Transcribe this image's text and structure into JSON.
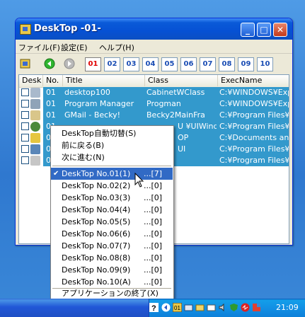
{
  "window": {
    "title": "DeskTop -01-",
    "minimize_glyph": "_",
    "maximize_glyph": "□",
    "close_glyph": "✕"
  },
  "menubar": [
    "ファイル(F)",
    "設定(E)",
    "ヘルプ(H)"
  ],
  "toolbar": {
    "tabs": [
      "01",
      "02",
      "03",
      "04",
      "05",
      "06",
      "07",
      "08",
      "09",
      "10"
    ],
    "active_tab": "01",
    "back_icon": "green-back-arrow-icon",
    "forward_icon": "gray-forward-arrow-icon",
    "menu_icon": "app-menu-icon"
  },
  "list": {
    "columns": [
      "Desk",
      "No.",
      "Title",
      "Class",
      "ExecName"
    ],
    "rows": [
      {
        "no": "01",
        "title": "desktop100",
        "class": "CabinetWClass",
        "exec": "C:¥WINDOWS¥Explo",
        "icon": "desktop-icon"
      },
      {
        "no": "01",
        "title": "Program Manager",
        "class": "Progman",
        "exec": "C:¥WINDOWS¥Explo",
        "icon": "program-manager-icon"
      },
      {
        "no": "01",
        "title": "GMail - Becky!",
        "class": "Becky2MainFra",
        "exec": "C:¥Program Files¥E",
        "icon": "becky-mail-icon"
      },
      {
        "no": "01",
        "title": "",
        "class": "U ¥UIWindo",
        "exec": "C:¥Program Files¥",
        "icon": "globe-icon"
      },
      {
        "no": "01",
        "title": "",
        "class": "OP",
        "exec": "C:¥Documents and",
        "icon": "folder-icon"
      },
      {
        "no": "01",
        "title": "",
        "class": "UI",
        "exec": "C:¥Program Files¥",
        "icon": "network-icon"
      },
      {
        "no": "01",
        "title": "",
        "class": "",
        "exec": "C:¥Program Files¥E",
        "icon": "music-icon"
      }
    ]
  },
  "context_menu": {
    "top_items": [
      "DeskTop自動切替(S)",
      "前に戻る(B)",
      "次に進む(N)"
    ],
    "desktops": [
      {
        "label": "DeskTop No.01(1)",
        "count": "...[7]",
        "checked": true
      },
      {
        "label": "DeskTop No.02(2)",
        "count": "...[0]",
        "checked": false
      },
      {
        "label": "DeskTop No.03(3)",
        "count": "...[0]",
        "checked": false
      },
      {
        "label": "DeskTop No.04(4)",
        "count": "...[0]",
        "checked": false
      },
      {
        "label": "DeskTop No.05(5)",
        "count": "...[0]",
        "checked": false
      },
      {
        "label": "DeskTop No.06(6)",
        "count": "...[0]",
        "checked": false
      },
      {
        "label": "DeskTop No.07(7)",
        "count": "...[0]",
        "checked": false
      },
      {
        "label": "DeskTop No.08(8)",
        "count": "...[0]",
        "checked": false
      },
      {
        "label": "DeskTop No.09(9)",
        "count": "...[0]",
        "checked": false
      },
      {
        "label": "DeskTop No.10(A)",
        "count": "...[0]",
        "checked": false
      }
    ],
    "exit": "アプリケーションの終了(X)",
    "check_glyph": "✔"
  },
  "taskbar": {
    "clock": "21:09",
    "tray_icons": [
      "help-icon",
      "back-icon",
      "desktop-number-icon",
      "network-icon",
      "folder-icon",
      "mail-icon",
      "speaker-icon",
      "security-icon",
      "antivirus-icon",
      "flag-icon"
    ]
  },
  "colors": {
    "selection": "#3399cc",
    "menu_highlight": "#316ac5",
    "active_tab_text": "#e00000",
    "tab_text": "#1a4db4"
  }
}
